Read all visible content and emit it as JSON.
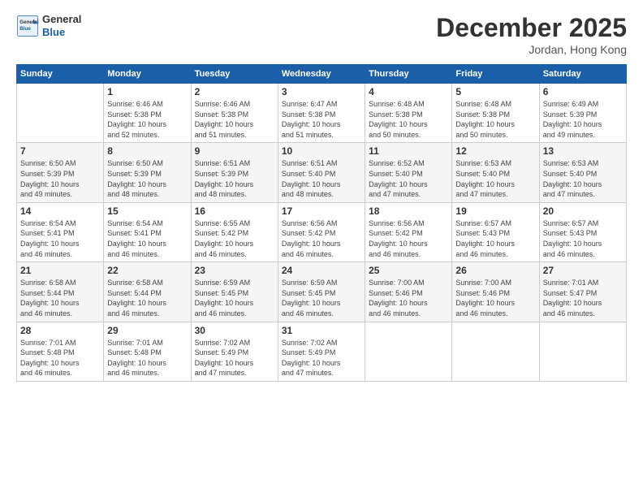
{
  "logo": {
    "line1": "General",
    "line2": "Blue"
  },
  "title": "December 2025",
  "location": "Jordan, Hong Kong",
  "days_header": [
    "Sunday",
    "Monday",
    "Tuesday",
    "Wednesday",
    "Thursday",
    "Friday",
    "Saturday"
  ],
  "weeks": [
    [
      {
        "day": "",
        "info": ""
      },
      {
        "day": "1",
        "info": "Sunrise: 6:46 AM\nSunset: 5:38 PM\nDaylight: 10 hours\nand 52 minutes."
      },
      {
        "day": "2",
        "info": "Sunrise: 6:46 AM\nSunset: 5:38 PM\nDaylight: 10 hours\nand 51 minutes."
      },
      {
        "day": "3",
        "info": "Sunrise: 6:47 AM\nSunset: 5:38 PM\nDaylight: 10 hours\nand 51 minutes."
      },
      {
        "day": "4",
        "info": "Sunrise: 6:48 AM\nSunset: 5:38 PM\nDaylight: 10 hours\nand 50 minutes."
      },
      {
        "day": "5",
        "info": "Sunrise: 6:48 AM\nSunset: 5:38 PM\nDaylight: 10 hours\nand 50 minutes."
      },
      {
        "day": "6",
        "info": "Sunrise: 6:49 AM\nSunset: 5:39 PM\nDaylight: 10 hours\nand 49 minutes."
      }
    ],
    [
      {
        "day": "7",
        "info": "Sunrise: 6:50 AM\nSunset: 5:39 PM\nDaylight: 10 hours\nand 49 minutes."
      },
      {
        "day": "8",
        "info": "Sunrise: 6:50 AM\nSunset: 5:39 PM\nDaylight: 10 hours\nand 48 minutes."
      },
      {
        "day": "9",
        "info": "Sunrise: 6:51 AM\nSunset: 5:39 PM\nDaylight: 10 hours\nand 48 minutes."
      },
      {
        "day": "10",
        "info": "Sunrise: 6:51 AM\nSunset: 5:40 PM\nDaylight: 10 hours\nand 48 minutes."
      },
      {
        "day": "11",
        "info": "Sunrise: 6:52 AM\nSunset: 5:40 PM\nDaylight: 10 hours\nand 47 minutes."
      },
      {
        "day": "12",
        "info": "Sunrise: 6:53 AM\nSunset: 5:40 PM\nDaylight: 10 hours\nand 47 minutes."
      },
      {
        "day": "13",
        "info": "Sunrise: 6:53 AM\nSunset: 5:40 PM\nDaylight: 10 hours\nand 47 minutes."
      }
    ],
    [
      {
        "day": "14",
        "info": "Sunrise: 6:54 AM\nSunset: 5:41 PM\nDaylight: 10 hours\nand 46 minutes."
      },
      {
        "day": "15",
        "info": "Sunrise: 6:54 AM\nSunset: 5:41 PM\nDaylight: 10 hours\nand 46 minutes."
      },
      {
        "day": "16",
        "info": "Sunrise: 6:55 AM\nSunset: 5:42 PM\nDaylight: 10 hours\nand 46 minutes."
      },
      {
        "day": "17",
        "info": "Sunrise: 6:56 AM\nSunset: 5:42 PM\nDaylight: 10 hours\nand 46 minutes."
      },
      {
        "day": "18",
        "info": "Sunrise: 6:56 AM\nSunset: 5:42 PM\nDaylight: 10 hours\nand 46 minutes."
      },
      {
        "day": "19",
        "info": "Sunrise: 6:57 AM\nSunset: 5:43 PM\nDaylight: 10 hours\nand 46 minutes."
      },
      {
        "day": "20",
        "info": "Sunrise: 6:57 AM\nSunset: 5:43 PM\nDaylight: 10 hours\nand 46 minutes."
      }
    ],
    [
      {
        "day": "21",
        "info": "Sunrise: 6:58 AM\nSunset: 5:44 PM\nDaylight: 10 hours\nand 46 minutes."
      },
      {
        "day": "22",
        "info": "Sunrise: 6:58 AM\nSunset: 5:44 PM\nDaylight: 10 hours\nand 46 minutes."
      },
      {
        "day": "23",
        "info": "Sunrise: 6:59 AM\nSunset: 5:45 PM\nDaylight: 10 hours\nand 46 minutes."
      },
      {
        "day": "24",
        "info": "Sunrise: 6:59 AM\nSunset: 5:45 PM\nDaylight: 10 hours\nand 46 minutes."
      },
      {
        "day": "25",
        "info": "Sunrise: 7:00 AM\nSunset: 5:46 PM\nDaylight: 10 hours\nand 46 minutes."
      },
      {
        "day": "26",
        "info": "Sunrise: 7:00 AM\nSunset: 5:46 PM\nDaylight: 10 hours\nand 46 minutes."
      },
      {
        "day": "27",
        "info": "Sunrise: 7:01 AM\nSunset: 5:47 PM\nDaylight: 10 hours\nand 46 minutes."
      }
    ],
    [
      {
        "day": "28",
        "info": "Sunrise: 7:01 AM\nSunset: 5:48 PM\nDaylight: 10 hours\nand 46 minutes."
      },
      {
        "day": "29",
        "info": "Sunrise: 7:01 AM\nSunset: 5:48 PM\nDaylight: 10 hours\nand 46 minutes."
      },
      {
        "day": "30",
        "info": "Sunrise: 7:02 AM\nSunset: 5:49 PM\nDaylight: 10 hours\nand 47 minutes."
      },
      {
        "day": "31",
        "info": "Sunrise: 7:02 AM\nSunset: 5:49 PM\nDaylight: 10 hours\nand 47 minutes."
      },
      {
        "day": "",
        "info": ""
      },
      {
        "day": "",
        "info": ""
      },
      {
        "day": "",
        "info": ""
      }
    ]
  ]
}
